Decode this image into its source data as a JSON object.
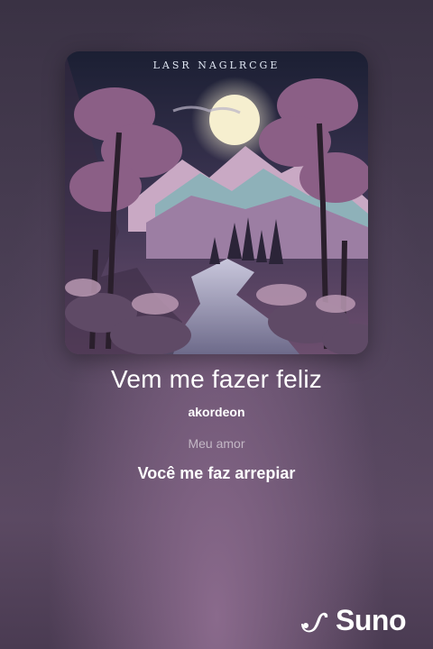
{
  "cover": {
    "inscription": "LASR NAGLRCGE"
  },
  "song": {
    "title": "Vem me fazer feliz",
    "artist": "akordeon"
  },
  "lyrics": {
    "previous_line": "Meu amor",
    "current_line": "Você me faz arrepiar"
  },
  "brand": {
    "name": "Suno",
    "icon": "suno-logo-icon"
  }
}
